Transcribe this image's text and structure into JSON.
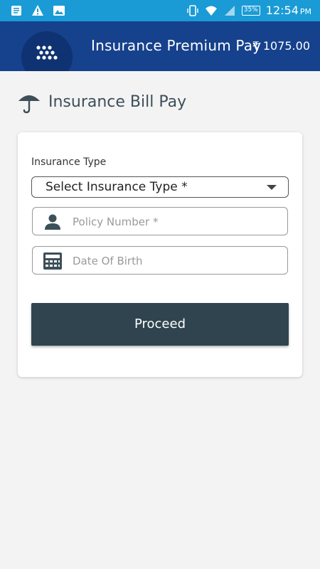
{
  "status_bar": {
    "time": "12:54",
    "ampm": "PM",
    "battery": "35%",
    "icons": [
      "notification-icon",
      "warning-icon",
      "image-icon",
      "vibrate-icon",
      "wifi-icon",
      "signal-icon"
    ]
  },
  "header": {
    "title": "Insurance Premium Pay",
    "amount": "₹ 1075.00",
    "logo_icon": "dots-logo-icon"
  },
  "page": {
    "heading": "Insurance Bill Pay",
    "heading_icon": "umbrella-icon"
  },
  "form": {
    "insurance_type_label": "Insurance Type",
    "insurance_type_value": "Select Insurance Type *",
    "policy_placeholder": "Policy Number *",
    "dob_placeholder": "Date Of Birth",
    "proceed_label": "Proceed"
  },
  "colors": {
    "status_bar": "#1a9bd6",
    "header": "#16418c",
    "button": "#2f444e",
    "background": "#f3f3f3"
  }
}
